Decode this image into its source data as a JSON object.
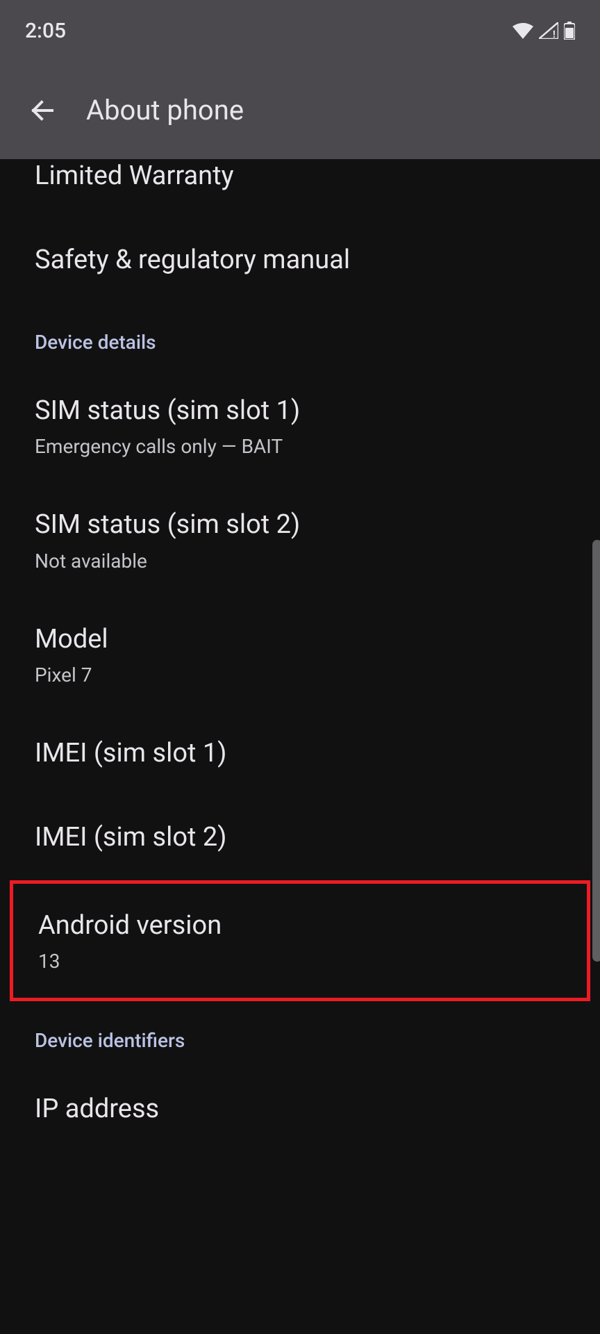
{
  "status_bar": {
    "time": "2:05"
  },
  "app_bar": {
    "title": "About phone"
  },
  "items": {
    "limited_warranty": {
      "title": "Limited Warranty"
    },
    "safety_manual": {
      "title": "Safety & regulatory manual"
    },
    "sim_status_1": {
      "title": "SIM status (sim slot 1)",
      "subtitle": "Emergency calls only — BAIT"
    },
    "sim_status_2": {
      "title": "SIM status (sim slot 2)",
      "subtitle": "Not available"
    },
    "model": {
      "title": "Model",
      "subtitle": "Pixel 7"
    },
    "imei_1": {
      "title": "IMEI (sim slot 1)"
    },
    "imei_2": {
      "title": "IMEI (sim slot 2)"
    },
    "android_version": {
      "title": "Android version",
      "subtitle": "13"
    },
    "ip_address": {
      "title": "IP address"
    }
  },
  "sections": {
    "device_details": "Device details",
    "device_identifiers": "Device identifiers"
  }
}
